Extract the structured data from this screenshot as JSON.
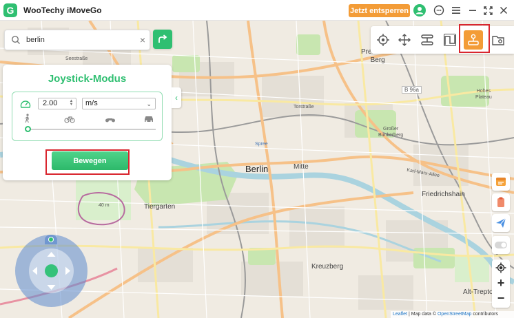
{
  "window": {
    "app_title": "WooTechy iMoveGo",
    "upgrade_label": "Jetzt entsperren",
    "icons": [
      "avatar-icon",
      "chat-icon",
      "menu-icon",
      "minimize-icon",
      "fullscreen-icon",
      "close-icon"
    ]
  },
  "search": {
    "value": "berlin",
    "placeholder": "",
    "clear_symbol": "×"
  },
  "mode_toolbar": {
    "modes": [
      {
        "name": "teleport-mode",
        "icon": "crosshair-icon",
        "active": false
      },
      {
        "name": "move-mode",
        "icon": "move-icon",
        "active": false
      },
      {
        "name": "multi-spot-mode",
        "icon": "multi-route-icon",
        "active": false
      },
      {
        "name": "two-spot-mode",
        "icon": "route-icon",
        "active": false
      },
      {
        "name": "joystick-mode",
        "icon": "joystick-icon",
        "active": true
      },
      {
        "name": "saved-mode",
        "icon": "folder-icon",
        "active": false
      }
    ]
  },
  "joystick_panel": {
    "title": "Joystick-Modus",
    "speed_value": "2.00",
    "speed_unit": "m/s",
    "speed_modes": [
      "walk-icon",
      "bike-icon",
      "motorbike-icon",
      "car-icon"
    ],
    "speed_slider_fraction": 0.0,
    "move_button": "Bewegen",
    "collapse_symbol": "‹"
  },
  "map": {
    "labels": {
      "berlin": "Berlin",
      "mitte": "Mitte",
      "tiergarten": "Tiergarten",
      "kreuzberg": "Kreuzberg",
      "friedrichshain": "Friedrichshain",
      "prenzlauer_berg": "Prenzlauer\nBerg",
      "hoher_plateau": "Hohes\nPlateau",
      "grosser_bunkerberg": "Großer\nBunkerberg",
      "alt_treptow": "Alt-Treptow",
      "b96a": "B 96a",
      "seestrasse": "Seestraße",
      "karl_marx_allee": "Karl-Marx-Allee",
      "torstrasse": "Torstraße",
      "spree": "Spree",
      "hoehe_40m": "40 m"
    }
  },
  "right_tools": {
    "icons": [
      "history-icon",
      "clipboard-icon",
      "send-icon",
      "toggle-icon",
      "locate-icon"
    ],
    "zoom_in": "+",
    "zoom_out": "−"
  },
  "attribution": {
    "leaflet": "Leaflet",
    "separator": " | Map data © ",
    "osm": "OpenStreetMap",
    "suffix": " contributors"
  },
  "colors": {
    "brand_green": "#2fbf71",
    "accent_orange": "#f39c37",
    "highlight_red": "#d9262f"
  }
}
